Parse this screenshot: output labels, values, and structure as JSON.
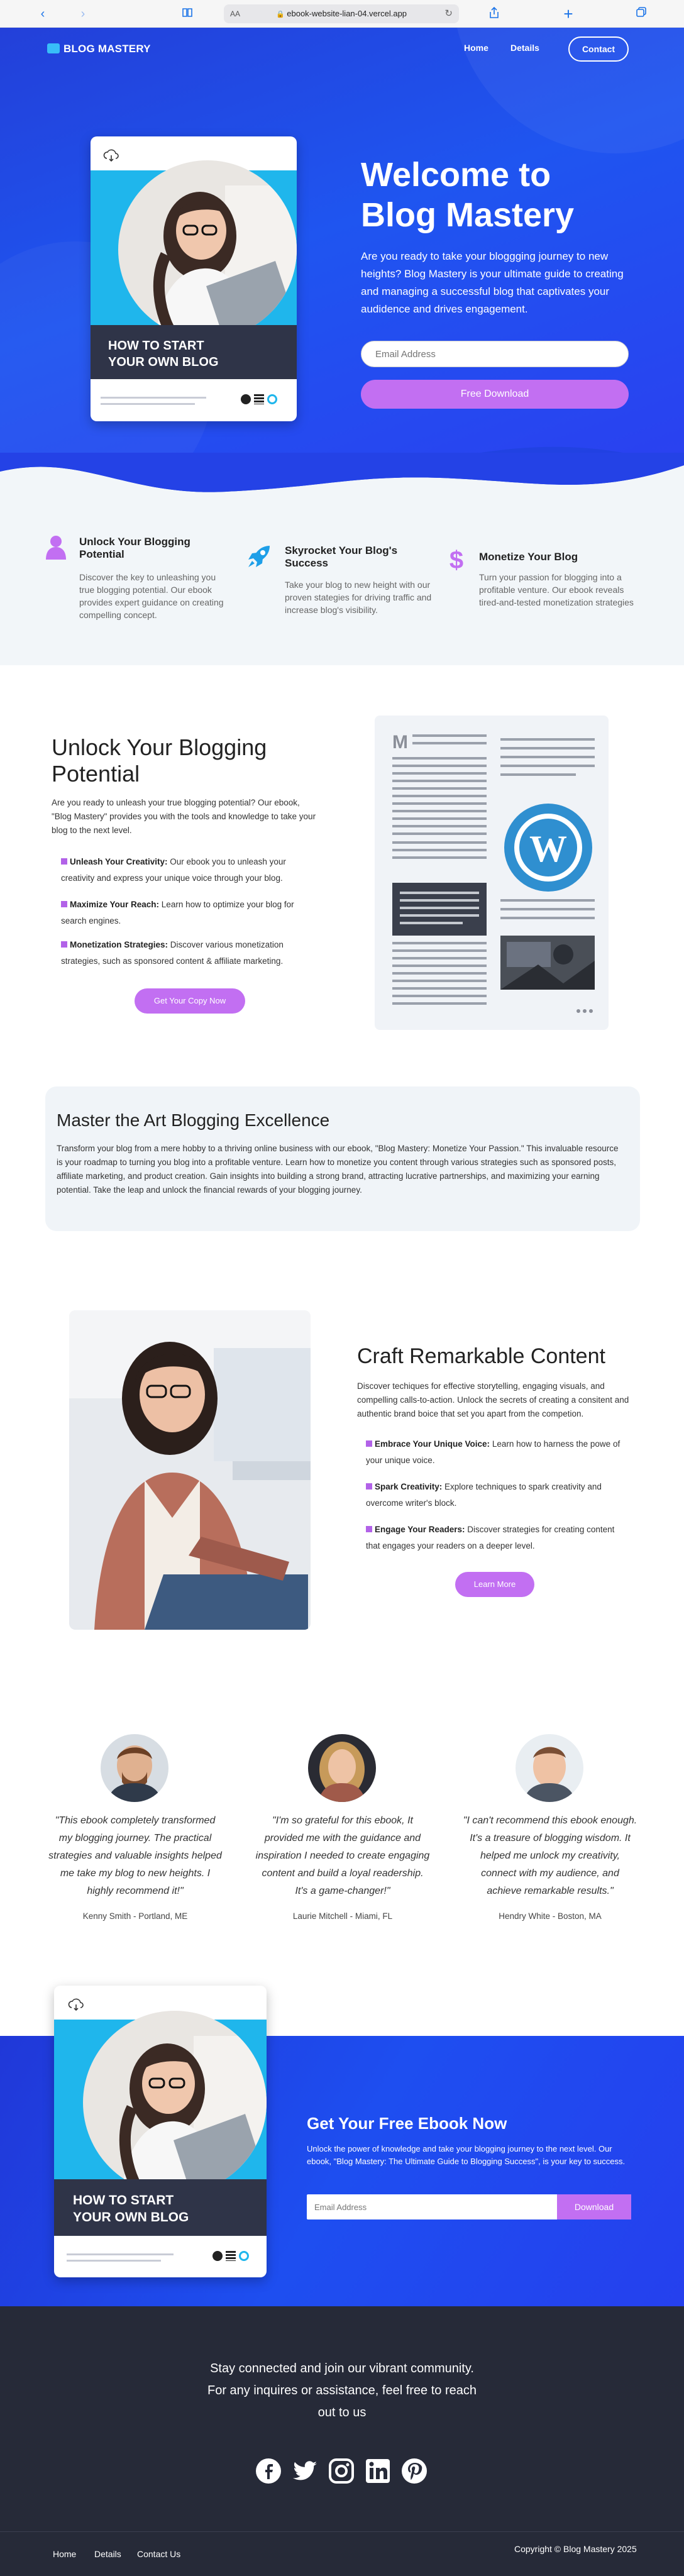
{
  "browser": {
    "aa": "AA",
    "url": "ebook-website-lian-04.vercel.app"
  },
  "nav": {
    "brand": "BLOG MASTERY",
    "home": "Home",
    "details": "Details",
    "contact": "Contact"
  },
  "hero": {
    "title_line1": "Welcome to",
    "title_line2": "Blog Mastery",
    "text": "Are you ready to take your bloggging journey to new heights? Blog Mastery is your ultimate guide to creating and managing a successful blog that captivates your audidence and drives engagement.",
    "email_placeholder": "Email Address",
    "download_label": "Free Download"
  },
  "book": {
    "title_line1": "HOW TO START",
    "title_line2": "YOUR OWN BLOG"
  },
  "features": [
    {
      "icon": "person-icon",
      "title": "Unlock Your Blogging Potential",
      "text": "Discover the key to unleashing you true blogging potential. Our ebook provides expert guidance on creating compelling concept."
    },
    {
      "icon": "rocket-icon",
      "title": "Skyrocket Your Blog's Success",
      "text": "Take your blog to new height with our proven stategies for driving traffic and increase blog's visibility."
    },
    {
      "icon": "dollar-icon",
      "title": "Monetize Your Blog",
      "text": "Turn your passion for blogging into a profitable venture. Our ebook reveals tired-and-tested monetization strategies"
    }
  ],
  "unlock": {
    "heading_line1": "Unlock Your Blogging",
    "heading_line2": "Potential",
    "intro": "Are you ready to unleash your true blogging potential? Our ebook, \"Blog Mastery\" provides you with the tools and knowledge to take your blog to the next level.",
    "bullets": [
      {
        "title": "Unleash Your Creativity:",
        "text": " Our ebook you to unleash your creativity and express your unique voice through your blog."
      },
      {
        "title": "Maximize Your Reach:",
        "text": " Learn how to optimize your blog for search engines."
      },
      {
        "title": "Monetization Strategies:",
        "text": " Discover various monetization strategies, such as sponsored content & affiliate marketing."
      }
    ],
    "button": "Get Your Copy Now",
    "doc_letter": "M"
  },
  "master": {
    "heading": "Master the Art Blogging Excellence",
    "text": "Transform your blog from a mere hobby to a thriving online business with our ebook, \"Blog Mastery: Monetize Your Passion.\" This invaluable resource is your roadmap to turning you blog into a profitable venture. Learn how to monetize you content through various strategies such as sponsored posts, affiliate marketing, and product creation. Gain insights into building a strong brand, attracting lucrative partnerships, and maximizing your earning potential. Take the leap and unlock the financial rewards of your blogging journey."
  },
  "craft": {
    "heading": "Craft Remarkable Content",
    "intro": "Discover techiques for effective storytelling, engaging visuals, and compelling calls-to-action. Unlock the secrets of creating a consitent and authentic brand boice that set you apart from the competion.",
    "bullets": [
      {
        "title": "Embrace Your Unique Voice:",
        "text": " Learn how to harness the powe of your unique voice."
      },
      {
        "title": "Spark Creativity:",
        "text": " Explore techniques to spark creativity and overcome writer's block."
      },
      {
        "title": "Engage Your Readers:",
        "text": " Discover strategies for creating content that engages your readers on a deeper level."
      }
    ],
    "button": "Learn More"
  },
  "testimonials": [
    {
      "quote": "\"This ebook completely transformed my blogging journey. The practical strategies and valuable insights helped me take my blog to new heights. I highly recommend it!\"",
      "name": "Kenny Smith - Portland, ME"
    },
    {
      "quote": "\"I'm so grateful for this ebook, It provided me with the guidance and inspiration I needed to create engaging content and build a loyal readership. It's a game-changer!\"",
      "name": "Laurie Mitchell - Miami, FL"
    },
    {
      "quote": "\"I can't recommend this ebook enough. It's a treasure of blogging wisdom. It helped me unlock my creativity, connect with my audience, and achieve remarkable results.\"",
      "name": "Hendry White - Boston, MA"
    }
  ],
  "cta": {
    "heading": "Get Your Free Ebook Now",
    "text": "Unlock the power of knowledge and take your blogging journey to the next level. Our ebook, \"Blog Mastery: The Ultimate Guide to Blogging Success\", is your key to success.",
    "email_placeholder": "Email Address",
    "button": "Download"
  },
  "footer": {
    "line1": "Stay connected and join our vibrant community.",
    "line2": "For any inquires or assistance, feel free to reach",
    "line3": "out to us",
    "social": [
      "facebook-icon",
      "twitter-icon",
      "instagram-icon",
      "linkedin-icon",
      "pinterest-icon"
    ],
    "links": [
      "Home",
      "Details",
      "Contact Us"
    ],
    "copyright": "Copyright © Blog Mastery 2025"
  },
  "colors": {
    "hero_blue": "#1f55f0",
    "accent_purple": "#c26ff2",
    "footer_dark": "#262a38",
    "book_cyan": "#1fb6ec"
  }
}
